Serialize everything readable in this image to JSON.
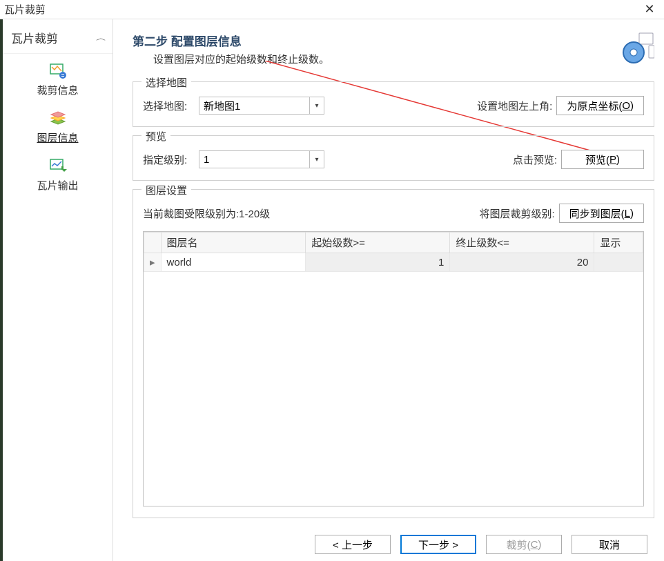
{
  "window": {
    "title": "瓦片裁剪"
  },
  "sidebar": {
    "title": "瓦片裁剪",
    "items": [
      {
        "label": "裁剪信息"
      },
      {
        "label": "图层信息"
      },
      {
        "label": "瓦片输出"
      }
    ]
  },
  "header": {
    "title": "第二步 配置图层信息",
    "subtitle": "设置图层对应的起始级数和终止级数。"
  },
  "map_select": {
    "legend": "选择地图",
    "label": "选择地图:",
    "value": "新地图1",
    "corner_label": "设置地图左上角:",
    "corner_btn": "为原点坐标(",
    "corner_btn_suffix": ")",
    "corner_mnemonic": "O"
  },
  "preview": {
    "legend": "预览",
    "level_label": "指定级别:",
    "level_value": "1",
    "click_label": "点击预览:",
    "btn": "预览(",
    "btn_suffix": ")",
    "mnemonic": "P"
  },
  "layer": {
    "legend": "图层设置",
    "limit_text": "当前裁图受限级别为:1-20级",
    "sync_label": "将图层裁剪级别:",
    "sync_btn": "同步到图层(",
    "sync_btn_suffix": ")",
    "sync_mnemonic": "L",
    "cols": {
      "name": "图层名",
      "start": "起始级数>=",
      "end": "终止级数<=",
      "show": "显示"
    },
    "rows": [
      {
        "name": "world",
        "start": "1",
        "end": "20",
        "show": ""
      }
    ]
  },
  "footer": {
    "back": "< 上一步",
    "next": "下一步 >",
    "crop": "裁剪(",
    "crop_suffix": ")",
    "crop_mnemonic": "C",
    "cancel": "取消"
  }
}
